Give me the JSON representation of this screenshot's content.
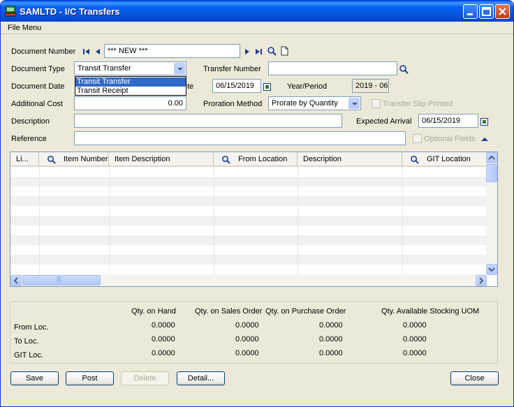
{
  "window": {
    "title": "SAMLTD - I/C Transfers"
  },
  "menu": {
    "file": "File Menu"
  },
  "form": {
    "document_number_label": "Document Number",
    "document_number_value": "*** NEW ***",
    "document_type_label": "Document Type",
    "document_type_value": "Transit Transfer",
    "document_type_options": [
      "Transit Transfer",
      "Transit Receipt"
    ],
    "transfer_number_label": "Transfer Number",
    "transfer_number_value": "",
    "document_date_label": "Document Date",
    "document_date_label_tail": "te",
    "document_date_value": "06/15/2019",
    "year_period_label": "Year/Period",
    "year_period_value": "2019 - 06",
    "additional_cost_label": "Additional Cost",
    "additional_cost_value": "0.00",
    "proration_method_label": "Proration Method",
    "proration_method_value": "Prorate by Quantity",
    "transfer_slip_label": "Transfer Slip Printed",
    "description_label": "Description",
    "description_value": "",
    "expected_arrival_label": "Expected Arrival",
    "expected_arrival_value": "06/15/2019",
    "reference_label": "Reference",
    "reference_value": "",
    "optional_fields_label": "Optional Fields"
  },
  "grid": {
    "columns": [
      "Li...",
      "Item Number",
      "Item Description",
      "From Location",
      "Description",
      "GIT Location"
    ],
    "scroll_grip": "|||"
  },
  "quantities": {
    "headers": [
      "Qty. on Hand",
      "Qty. on Sales Order",
      "Qty. on Purchase Order",
      "Qty. Available Stocking UOM"
    ],
    "rows": [
      {
        "label": "From Loc.",
        "values": [
          "0.0000",
          "0.0000",
          "0.0000",
          "0.0000"
        ]
      },
      {
        "label": "To Loc.",
        "values": [
          "0.0000",
          "0.0000",
          "0.0000",
          "0.0000"
        ]
      },
      {
        "label": "GIT Loc.",
        "values": [
          "0.0000",
          "0.0000",
          "0.0000",
          "0.0000"
        ]
      }
    ]
  },
  "buttons": {
    "save": "Save",
    "post": "Post",
    "delete": "Delete",
    "detail": "Detail...",
    "close": "Close"
  }
}
